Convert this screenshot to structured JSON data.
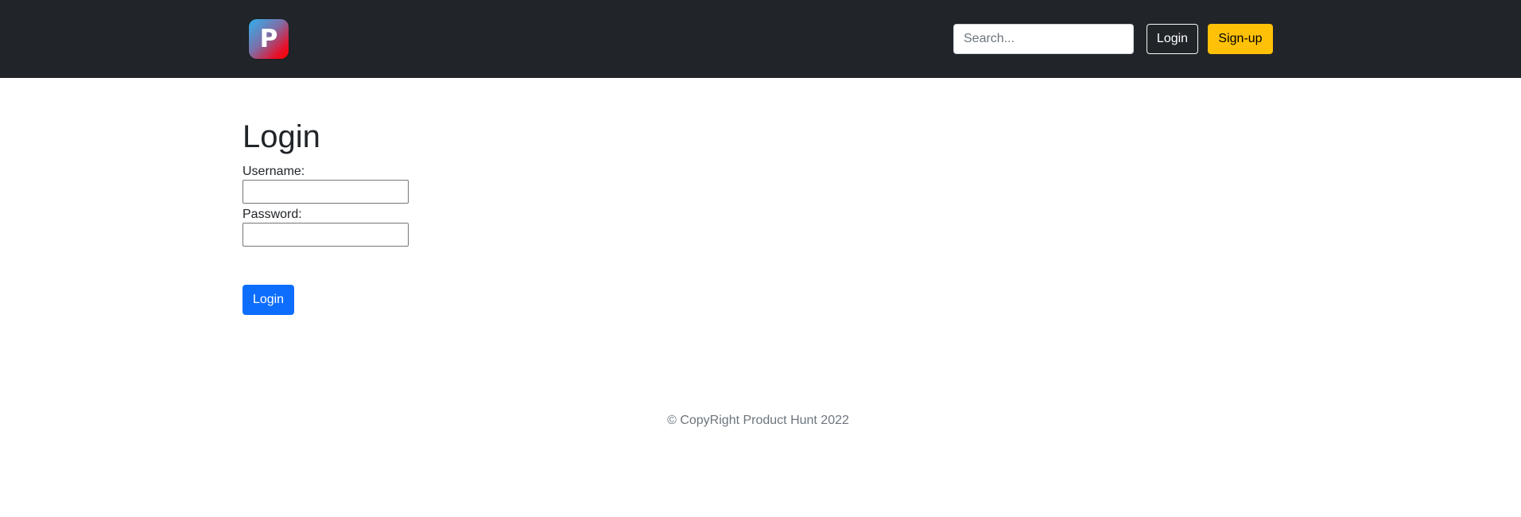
{
  "navbar": {
    "logo": {
      "letter": "P",
      "icon": "product-hunt-logo-icon"
    },
    "search": {
      "placeholder": "Search...",
      "value": ""
    },
    "login_label": "Login",
    "signup_label": "Sign-up"
  },
  "form": {
    "title": "Login",
    "username_label": "Username:",
    "username_value": "",
    "password_label": "Password:",
    "password_value": "",
    "submit_label": "Login"
  },
  "footer": {
    "text": "© CopyRight Product Hunt 2022"
  },
  "colors": {
    "navbar_bg": "#212529",
    "primary": "#0d6efd",
    "warning": "#ffc107",
    "muted_text": "#6c757d"
  }
}
